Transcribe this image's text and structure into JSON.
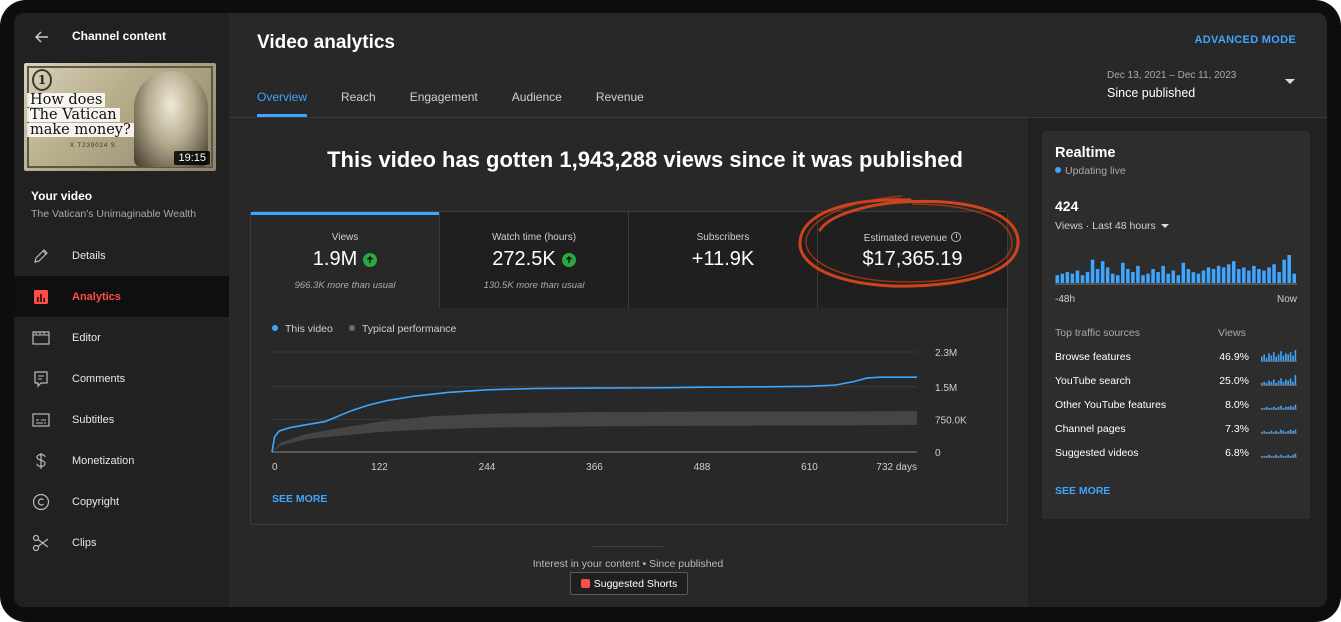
{
  "sidebar": {
    "title": "Channel content",
    "thumbnail": {
      "lines": [
        "How does",
        "The Vatican",
        "make money?"
      ],
      "duration": "19:15",
      "coin": "1",
      "serial": "X T239024 S"
    },
    "your_video_label": "Your video",
    "video_title": "The Vatican's Unimaginable Wealth",
    "nav": [
      {
        "label": "Details",
        "icon": "pencil-icon",
        "active": false
      },
      {
        "label": "Analytics",
        "icon": "analytics-icon",
        "active": true
      },
      {
        "label": "Editor",
        "icon": "editor-icon",
        "active": false
      },
      {
        "label": "Comments",
        "icon": "comments-icon",
        "active": false
      },
      {
        "label": "Subtitles",
        "icon": "subtitles-icon",
        "active": false
      },
      {
        "label": "Monetization",
        "icon": "dollar-icon",
        "active": false
      },
      {
        "label": "Copyright",
        "icon": "copyright-icon",
        "active": false
      },
      {
        "label": "Clips",
        "icon": "scissors-icon",
        "active": false
      }
    ]
  },
  "header": {
    "title": "Video analytics",
    "advanced_mode": "ADVANCED MODE",
    "tabs": [
      "Overview",
      "Reach",
      "Engagement",
      "Audience",
      "Revenue"
    ],
    "date_range": "Dec 13, 2021 – Dec 11, 2023",
    "date_label": "Since published"
  },
  "headline": "This video has gotten 1,943,288 views since it was published",
  "metrics": [
    {
      "label": "Views",
      "value": "1.9M",
      "note": "966.3K more than usual",
      "up": true
    },
    {
      "label": "Watch time (hours)",
      "value": "272.5K",
      "note": "130.5K more than usual",
      "up": true
    },
    {
      "label": "Subscribers",
      "value": "+11.9K",
      "note": "",
      "up": false
    },
    {
      "label": "Estimated revenue",
      "value": "$17,365.19",
      "note": "",
      "up": false
    }
  ],
  "chart": {
    "legend": [
      "This video",
      "Typical performance"
    ],
    "see_more": "SEE MORE"
  },
  "chart_data": {
    "type": "line",
    "x_tick_labels": [
      "0",
      "122",
      "244",
      "366",
      "488",
      "610",
      "732 days"
    ],
    "y_tick_labels": [
      "0",
      "750.0K",
      "1.5M",
      "2.3M"
    ],
    "ylim": [
      0,
      2300000
    ],
    "xlim": [
      0,
      732
    ],
    "series": [
      {
        "name": "This video",
        "color": "#3ea6ff",
        "x": [
          0,
          3,
          8,
          20,
          40,
          60,
          75,
          90,
          110,
          130,
          160,
          200,
          244,
          300,
          366,
          450,
          488,
          560,
          610,
          640,
          660,
          675,
          690,
          732
        ],
        "values": [
          0,
          350000,
          480000,
          560000,
          630000,
          700000,
          820000,
          950000,
          1080000,
          1180000,
          1280000,
          1370000,
          1430000,
          1460000,
          1470000,
          1480000,
          1490000,
          1500000,
          1510000,
          1540000,
          1620000,
          1700000,
          1720000,
          1720000
        ]
      },
      {
        "name": "Typical performance",
        "color": "#4a4a4a",
        "x": [
          0,
          10,
          40,
          80,
          122,
          180,
          244,
          366,
          488,
          610,
          732
        ],
        "low": [
          0,
          150000,
          300000,
          380000,
          460000,
          520000,
          560000,
          590000,
          600000,
          610000,
          620000
        ],
        "high": [
          0,
          220000,
          420000,
          560000,
          700000,
          820000,
          880000,
          920000,
          930000,
          930000,
          940000
        ]
      }
    ]
  },
  "interest": {
    "text": "Interest in your content • Since published",
    "button": "Suggested Shorts"
  },
  "realtime": {
    "title": "Realtime",
    "live": "Updating live",
    "count": "424",
    "views_label": "Views · Last 48 hours",
    "axis_left": "-48h",
    "axis_right": "Now",
    "hourly_bars": [
      5,
      6,
      7,
      6,
      8,
      5,
      7,
      15,
      9,
      14,
      10,
      6,
      5,
      13,
      9,
      7,
      11,
      5,
      6,
      9,
      7,
      11,
      6,
      8,
      5,
      13,
      9,
      7,
      6,
      8,
      10,
      9,
      11,
      10,
      12,
      14,
      9,
      10,
      8,
      11,
      9,
      8,
      10,
      12,
      7,
      15,
      18,
      6
    ],
    "traffic_header": "Top traffic sources",
    "traffic_views_header": "Views",
    "traffic": [
      {
        "name": "Browse features",
        "pct": "46.9%",
        "spark": [
          4,
          6,
          3,
          7,
          5,
          8,
          4,
          6,
          9,
          5,
          7,
          6,
          8,
          5,
          10
        ]
      },
      {
        "name": "YouTube search",
        "pct": "25.0%",
        "spark": [
          2,
          3,
          2,
          4,
          3,
          5,
          2,
          4,
          6,
          3,
          5,
          4,
          6,
          3,
          9
        ]
      },
      {
        "name": "Other YouTube features",
        "pct": "8.0%",
        "spark": [
          1,
          1,
          2,
          1,
          1,
          2,
          1,
          2,
          3,
          1,
          2,
          2,
          3,
          2,
          4
        ]
      },
      {
        "name": "Channel pages",
        "pct": "7.3%",
        "spark": [
          1,
          2,
          1,
          1,
          2,
          1,
          2,
          1,
          3,
          2,
          1,
          2,
          3,
          2,
          3
        ]
      },
      {
        "name": "Suggested videos",
        "pct": "6.8%",
        "spark": [
          1,
          1,
          1,
          2,
          1,
          1,
          2,
          1,
          2,
          1,
          1,
          2,
          1,
          2,
          3
        ]
      }
    ],
    "see_more": "SEE MORE"
  },
  "colors": {
    "accent": "#3ea6ff",
    "active_nav": "#ff4e45",
    "up_badge": "#2ba640",
    "annotation": "#e0471d"
  }
}
